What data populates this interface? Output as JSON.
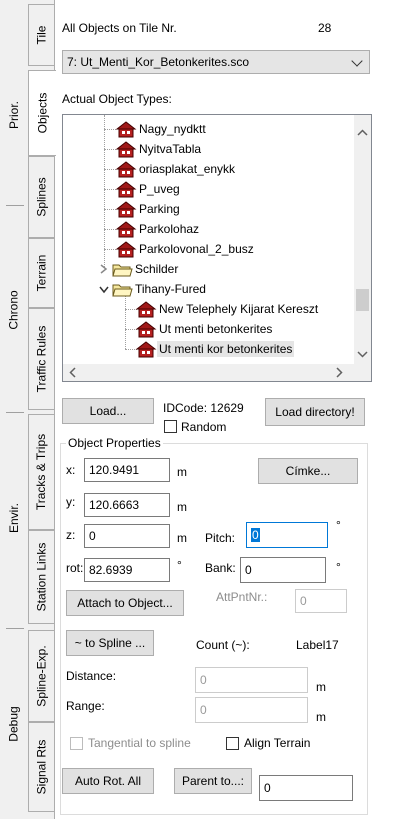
{
  "tabs": {
    "groups": [
      {
        "label": "Prior."
      },
      {
        "label": "Chrono"
      },
      {
        "label": "Envir."
      },
      {
        "label": "Debug"
      }
    ],
    "items": [
      {
        "label": "Tile"
      },
      {
        "label": "Objects"
      },
      {
        "label": "Splines"
      },
      {
        "label": "Terrain"
      },
      {
        "label": "Traffic Rules"
      },
      {
        "label": "Tracks & Trips"
      },
      {
        "label": "Station Links"
      },
      {
        "label": "Spline-Exp."
      },
      {
        "label": "Signal Rts"
      }
    ],
    "active": "Objects"
  },
  "header": {
    "all_objects_label": "All Objects on Tile Nr.",
    "tile_number": "28"
  },
  "object_select": {
    "value": "7: Ut_Menti_Kor_Betonkerites.sco"
  },
  "tree": {
    "title": "Actual Object Types:",
    "items": [
      {
        "label": "Nagy_nydktt",
        "icon": "house-icon"
      },
      {
        "label": "NyitvaTabla",
        "icon": "house-icon"
      },
      {
        "label": "oriasplakat_enykk",
        "icon": "house-icon"
      },
      {
        "label": "P_uveg",
        "icon": "house-icon"
      },
      {
        "label": "Parking",
        "icon": "house-icon"
      },
      {
        "label": "Parkolohaz",
        "icon": "house-icon"
      },
      {
        "label": "Parkolovonal_2_busz",
        "icon": "house-icon"
      },
      {
        "label": "Schilder",
        "icon": "folder-icon"
      },
      {
        "label": "Tihany-Fured",
        "icon": "folder-icon"
      },
      {
        "label": "New Telephely Kijarat Kereszt",
        "icon": "house-icon"
      },
      {
        "label": "Ut menti betonkerites",
        "icon": "house-icon"
      },
      {
        "label": "Ut menti kor betonkerites",
        "icon": "house-icon",
        "selected": true
      }
    ]
  },
  "actions": {
    "load_label": "Load...",
    "idcode_label": "IDCode: 12629",
    "random_label": "Random",
    "load_dir_label": "Load directory!"
  },
  "props": {
    "title": "Object Properties",
    "x_label": "x:",
    "x_value": "120.9491",
    "y_label": "y:",
    "y_value": "120.6663",
    "z_label": "z:",
    "z_value": "0",
    "rot_label": "rot:",
    "rot_value": "82.6939",
    "unit_m": "m",
    "deg": "°",
    "cimke_label": "Címke...",
    "pitch_label": "Pitch:",
    "pitch_value": "0",
    "bank_label": "Bank:",
    "bank_value": "0",
    "attach_label": "Attach to Object...",
    "attpnt_label": "AttPntNr.:",
    "attpnt_value": "0",
    "to_spline_label": "~ to Spline ...",
    "count_label": "Count (~):",
    "count_value": "Label17",
    "distance_label": "Distance:",
    "distance_value": "0",
    "range_label": "Range:",
    "range_value": "0",
    "tangential_label": "Tangential to spline",
    "align_terrain_label": "Align Terrain",
    "auto_rot_label": "Auto Rot. All",
    "parent_to_label": "Parent to...:",
    "parent_value": "0"
  }
}
